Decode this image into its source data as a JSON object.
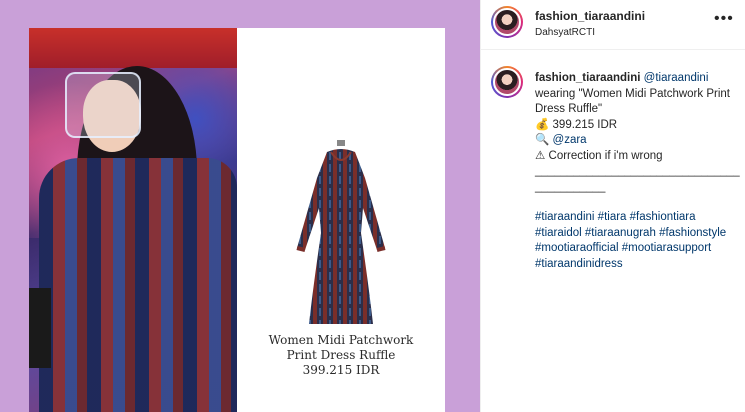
{
  "image": {
    "product_caption": {
      "line1": "Women Midi Patchwork",
      "line2": "Print Dress Ruffle",
      "price": "399.215 IDR"
    }
  },
  "header": {
    "username": "fashion_tiaraandini",
    "location": "DahsyatRCTI",
    "more_icon": "more-horizontal-icon"
  },
  "caption": {
    "username": "fashion_tiaraandini",
    "mention": "@tiaraandini",
    "wearing": "wearing \"Women Midi Patchwork Print Dress Ruffle\"",
    "price_emoji": "💰",
    "price": "399.215 IDR",
    "brand_emoji": "🔍",
    "brand": "@zara",
    "warning_emoji": "⚠",
    "note": "Correction if i'm wrong",
    "separator": "___________________________________________",
    "hashtags": [
      "#tiaraandini",
      "#tiara",
      "#fashiontiara",
      "#tiaraidol",
      "#tiaraanugrah",
      "#fashionstyle",
      "#mootiaraofficial",
      "#mootiarasupport",
      "#tiaraandinidress"
    ]
  },
  "colors": {
    "background": "#c9a0d8",
    "link": "#00376b",
    "text": "#262626"
  }
}
